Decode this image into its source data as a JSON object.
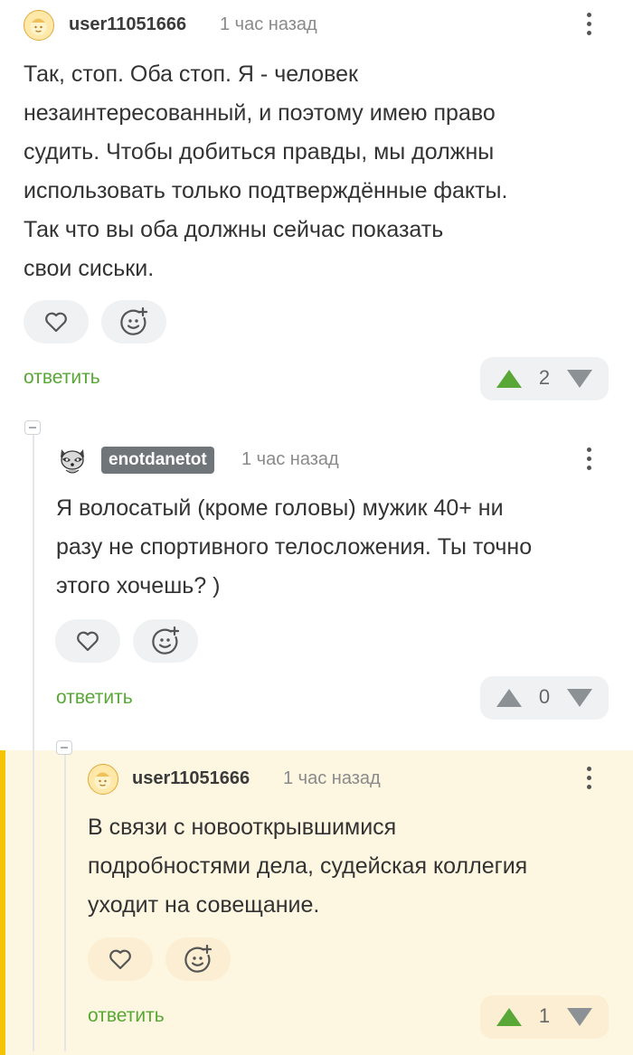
{
  "colors": {
    "accent_green": "#59a837",
    "highlight_bg": "#fdf6e0",
    "highlight_bar": "#f5c400"
  },
  "comment1": {
    "username": "user11051666",
    "time": "1 час назад",
    "lines": [
      "Так, стоп. Оба стоп. Я - человек",
      "незаинтересованный, и поэтому имею право",
      "судить. Чтобы добиться правды, мы должны",
      "использовать только подтверждённые факты.",
      "Так что вы оба должны сейчас показать",
      "свои сиськи."
    ],
    "reply_label": "ответить",
    "rating": "2",
    "upvoted": true
  },
  "comment2": {
    "username": "enotdanetot",
    "time": "1 час назад",
    "lines": [
      "Я волосатый (кроме головы) мужик 40+ ни",
      "разу не спортивного телосложения. Ты точно",
      "этого хочешь? )"
    ],
    "reply_label": "ответить",
    "rating": "0",
    "upvoted": false
  },
  "comment3": {
    "username": "user11051666",
    "time": "1 час назад",
    "lines": [
      "В связи с новооткрывшимися",
      "подробностями дела, судейская коллегия",
      "уходит на совещание."
    ],
    "reply_label": "ответить",
    "rating": "1",
    "upvoted": true
  }
}
